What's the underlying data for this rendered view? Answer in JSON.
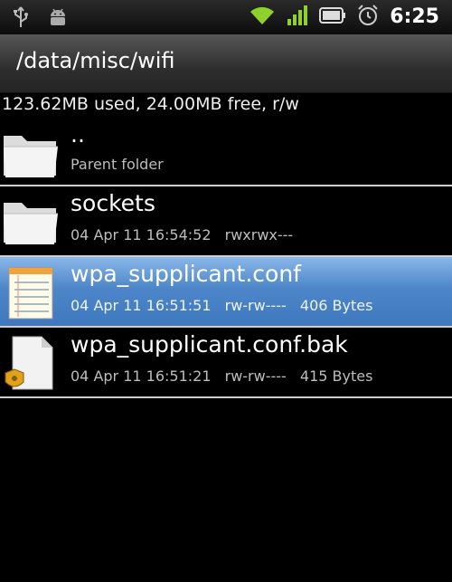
{
  "status_bar": {
    "icons_left": [
      "usb-icon",
      "android-debug-icon"
    ],
    "icons_right": [
      "wifi-icon",
      "signal-icon",
      "battery-icon",
      "alarm-icon"
    ],
    "time": "6:25"
  },
  "title_bar": {
    "path": "/data/misc/wifi"
  },
  "storage_info": "123.62MB used, 24.00MB free, r/w",
  "files": [
    {
      "name": "..",
      "subtitle": "Parent folder",
      "icon": "folder-icon"
    },
    {
      "name": "sockets",
      "date": "04 Apr 11 16:54:52",
      "perms": "rwxrwx---",
      "size": "",
      "icon": "folder-icon"
    },
    {
      "name": "wpa_supplicant.conf",
      "date": "04 Apr 11 16:51:51",
      "perms": "rw-rw----",
      "size": "406 Bytes",
      "icon": "text-file-icon",
      "selected": true
    },
    {
      "name": "wpa_supplicant.conf.bak",
      "date": "04 Apr 11 16:51:21",
      "perms": "rw-rw----",
      "size": "415 Bytes",
      "icon": "backup-file-icon"
    }
  ],
  "colors": {
    "selection": "#4d86c9",
    "divider": "#cfcfcf",
    "wifi": "#8fd12c"
  }
}
